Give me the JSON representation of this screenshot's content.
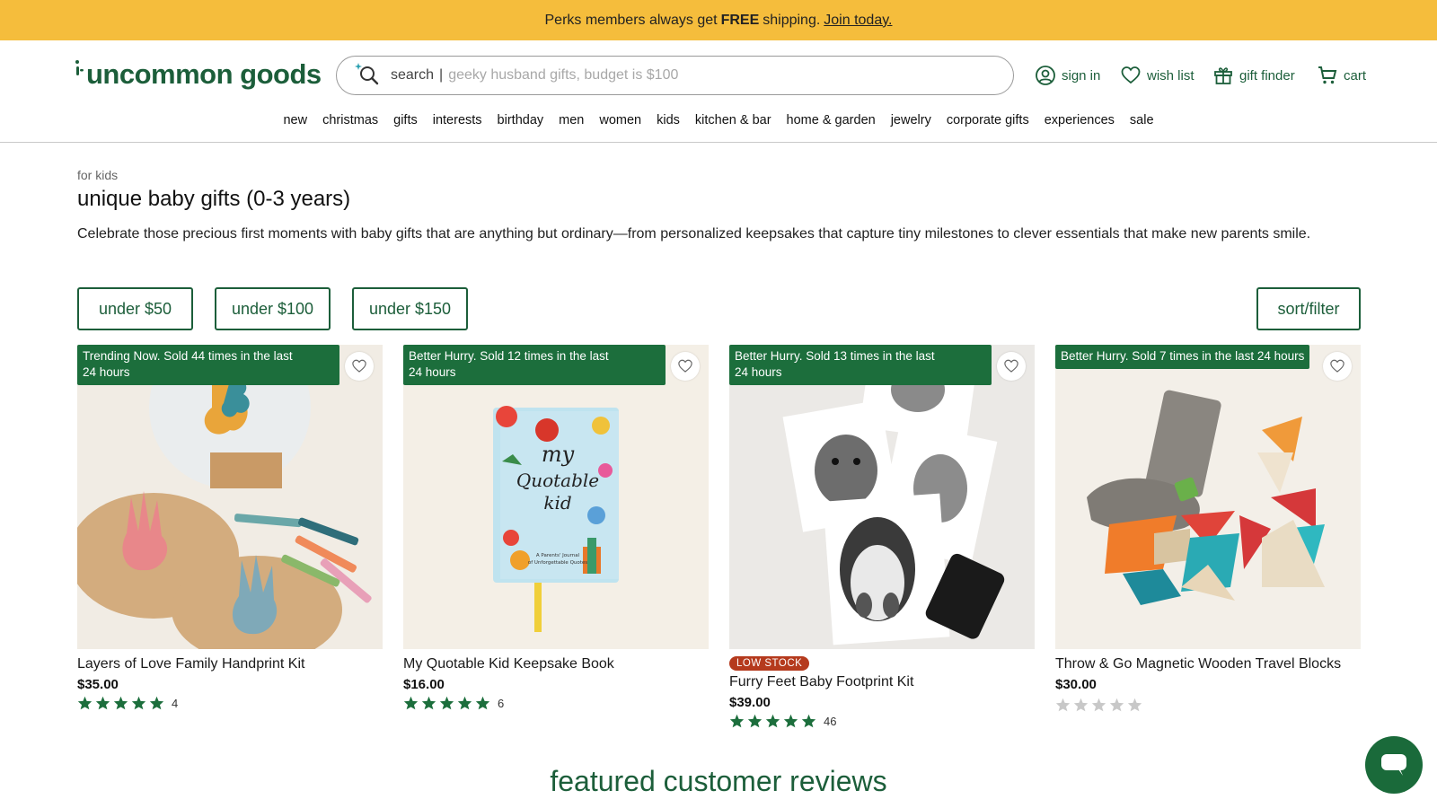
{
  "promo": {
    "text": "Perks members always get",
    "bold": "FREE",
    "tail": "shipping.",
    "link": "Join today."
  },
  "header": {
    "logo": "uncommon goods",
    "search_label": "search",
    "search_sep": "|",
    "search_placeholder": "geeky husband gifts, budget is $100",
    "sign_in": "sign in",
    "wish_list": "wish list",
    "gift_finder": "gift finder",
    "cart": "cart",
    "brand_color": "#1c5e3a",
    "promo_color": "#f5bd3c"
  },
  "nav": [
    "new",
    "christmas",
    "gifts",
    "interests",
    "birthday",
    "men",
    "women",
    "kids",
    "kitchen & bar",
    "home & garden",
    "jewelry",
    "corporate gifts",
    "experiences",
    "sale"
  ],
  "page": {
    "breadcrumb": "for kids",
    "title": "unique baby gifts (0-3 years)",
    "description": "Celebrate those precious first moments with baby gifts that are anything but ordinary—from personalized keepsakes that capture tiny milestones to clever essentials that make new parents smile."
  },
  "filters": {
    "under_50": "under $50",
    "under_100": "under $100",
    "under_150": "under $150",
    "sort_filter": "sort/filter"
  },
  "products": [
    {
      "badge_line1": "Trending Now. Sold 44 times in the last",
      "badge_line2": "24 hours",
      "name": "Layers of Love Family Handprint Kit",
      "price": "$35.00",
      "rating": 5,
      "reviews": "4",
      "low_stock": ""
    },
    {
      "badge_line1": "Better Hurry. Sold 12 times in the last",
      "badge_line2": "24 hours",
      "name": "My Quotable Kid Keepsake Book",
      "price": "$16.00",
      "rating": 5,
      "reviews": "6",
      "low_stock": ""
    },
    {
      "badge_line1": "Better Hurry. Sold 13 times in the last",
      "badge_line2": "24 hours",
      "name": "Furry Feet Baby Footprint Kit",
      "price": "$39.00",
      "rating": 5,
      "reviews": "46",
      "low_stock": "LOW STOCK"
    },
    {
      "badge_line1": "Better Hurry. Sold 7 times in the last 24 hours",
      "badge_line2": "",
      "name": "Throw & Go Magnetic Wooden Travel Blocks",
      "price": "$30.00",
      "rating": 0,
      "reviews": "",
      "low_stock": ""
    }
  ],
  "book_cover": {
    "line1": "my",
    "line2": "Quotable",
    "line3": "kid",
    "subtitle1": "A Parents' Journal",
    "subtitle2": "of Unforgettable Quotes"
  },
  "featured": "featured customer reviews",
  "icons": [
    "search-sparkle-icon",
    "user-circle-icon",
    "heart-icon",
    "gift-icon",
    "cart-icon",
    "chat-icon",
    "star-icon"
  ]
}
